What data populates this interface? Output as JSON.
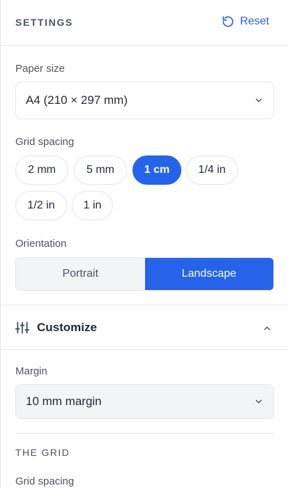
{
  "header": {
    "title": "SETTINGS",
    "reset_label": "Reset"
  },
  "paper_size": {
    "label": "Paper size",
    "value": "A4 (210 × 297 mm)"
  },
  "grid_spacing": {
    "label": "Grid spacing",
    "options": [
      "2 mm",
      "5 mm",
      "1 cm",
      "1/4 in",
      "1/2 in",
      "1 in"
    ],
    "selected": "1 cm"
  },
  "orientation": {
    "label": "Orientation",
    "options": [
      "Portrait",
      "Landscape"
    ],
    "selected": "Landscape"
  },
  "customize": {
    "title": "Customize",
    "margin_label": "Margin",
    "margin_value": "10 mm margin",
    "grid_heading": "THE GRID",
    "grid_spacing_label": "Grid spacing"
  },
  "icons": {
    "reset": "rotate-ccw-icon",
    "dropdown": "chevron-down-icon",
    "customize": "sliders-icon",
    "collapse": "chevron-up-icon"
  },
  "colors": {
    "accent": "#2563eb",
    "border": "#e5e7eb",
    "muted_bg": "#f3f4f6",
    "label": "#4b5563"
  }
}
